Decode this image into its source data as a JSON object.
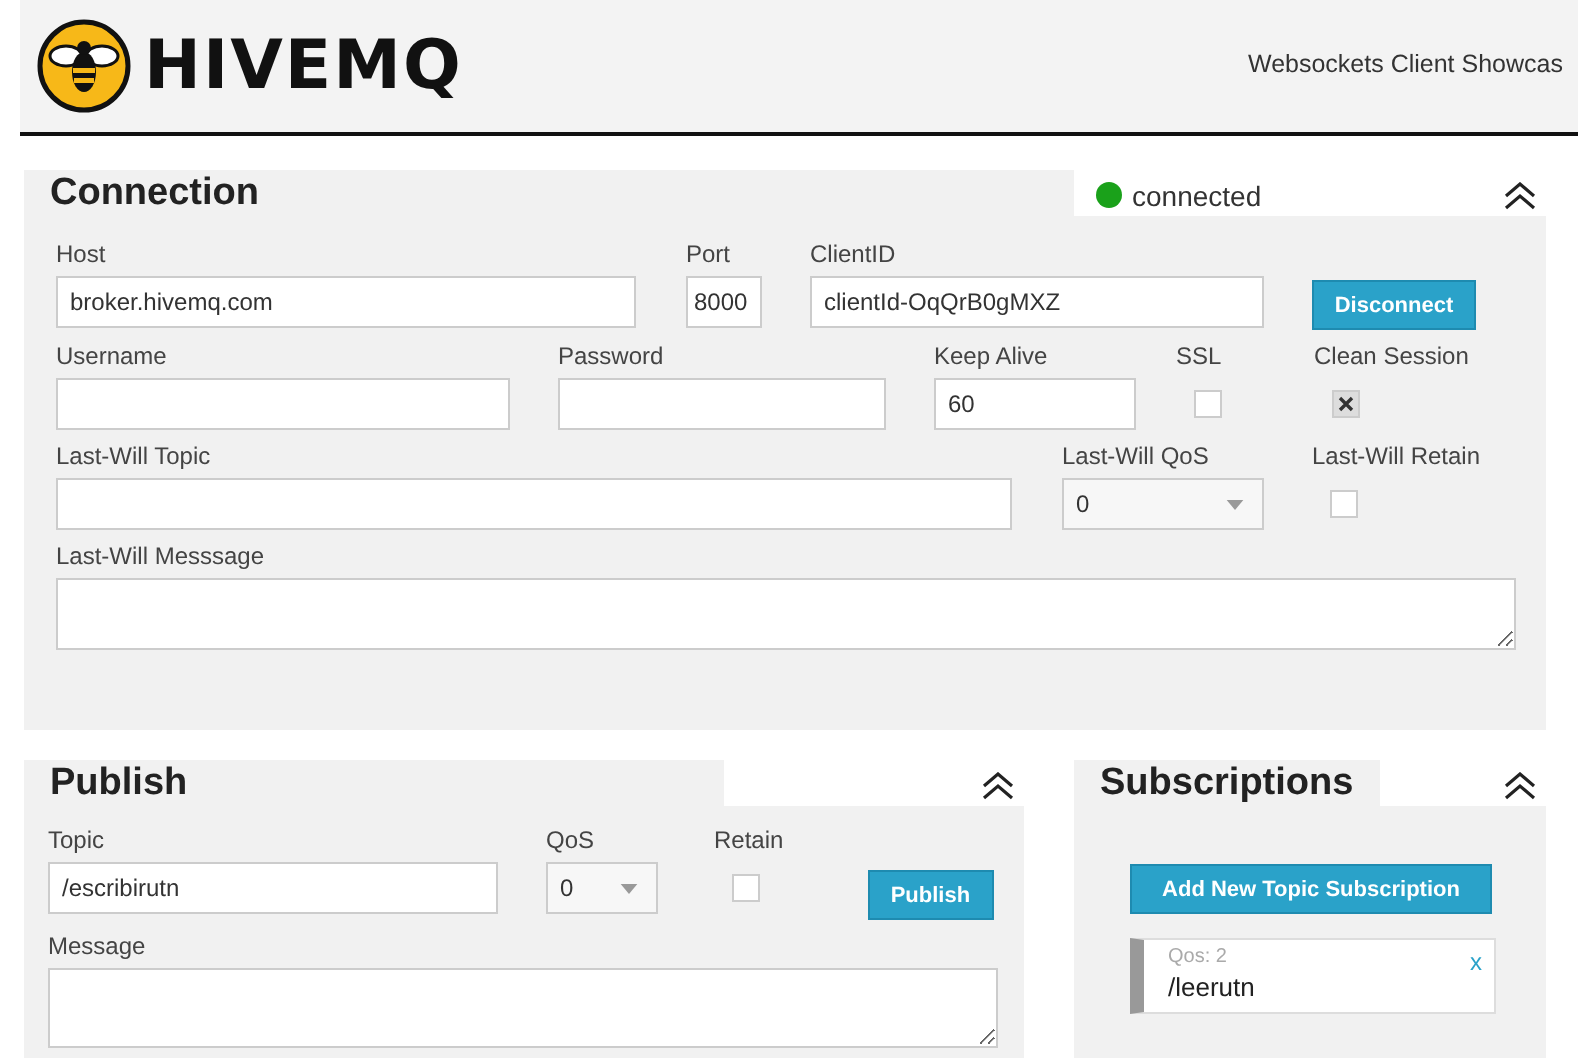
{
  "header": {
    "logo_text": "HIVEMQ",
    "subtitle": "Websockets Client Showcas"
  },
  "connection": {
    "title": "Connection",
    "status": {
      "text": "connected",
      "color": "#1aa11a"
    },
    "host": {
      "label": "Host",
      "value": "broker.hivemq.com"
    },
    "port": {
      "label": "Port",
      "value": "8000"
    },
    "client_id": {
      "label": "ClientID",
      "value": "clientId-OqQrB0gMXZ"
    },
    "disconnect_button": "Disconnect",
    "username": {
      "label": "Username"
    },
    "password": {
      "label": "Password"
    },
    "keep_alive": {
      "label": "Keep Alive",
      "value": "60"
    },
    "ssl": {
      "label": "SSL",
      "checked": false
    },
    "clean_session": {
      "label": "Clean Session",
      "checked": true
    },
    "last_will_topic": {
      "label": "Last-Will Topic"
    },
    "last_will_qos": {
      "label": "Last-Will QoS",
      "value": "0"
    },
    "last_will_retain": {
      "label": "Last-Will Retain",
      "checked": false
    },
    "last_will_message": {
      "label": "Last-Will Messsage"
    }
  },
  "publish": {
    "title": "Publish",
    "topic": {
      "label": "Topic",
      "value": "/escribirutn"
    },
    "qos": {
      "label": "QoS",
      "value": "0"
    },
    "retain": {
      "label": "Retain",
      "checked": false
    },
    "publish_button": "Publish",
    "message": {
      "label": "Message"
    }
  },
  "subscriptions": {
    "title": "Subscriptions",
    "add_button": "Add New Topic Subscription",
    "items": [
      {
        "qos": "Qos: 2",
        "topic": "/leerutn",
        "remove": "x",
        "color": "#999999"
      }
    ]
  }
}
